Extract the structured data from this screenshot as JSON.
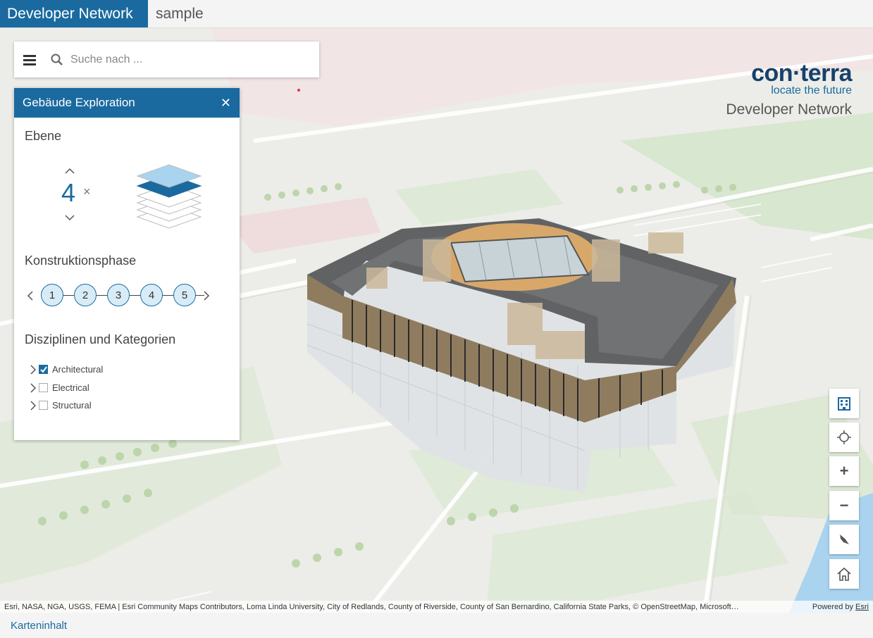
{
  "header": {
    "brand": "Developer Network",
    "app_name": "sample"
  },
  "search": {
    "placeholder": "Suche nach ..."
  },
  "panel": {
    "title": "Gebäude Exploration",
    "level_section": "Ebene",
    "level_value": "4",
    "level_clear": "×",
    "phase_section": "Konstruktionsphase",
    "phases": [
      "1",
      "2",
      "3",
      "4",
      "5"
    ],
    "disciplines_section": "Disziplinen und Kategorien",
    "categories": [
      {
        "label": "Architectural",
        "checked": true
      },
      {
        "label": "Electrical",
        "checked": false
      },
      {
        "label": "Structural",
        "checked": false
      }
    ]
  },
  "logo": {
    "main": "con·terra",
    "tagline": "locate the future",
    "network": "Developer Network"
  },
  "tools": [
    "building-icon",
    "locate-icon",
    "zoom-in-icon",
    "zoom-out-icon",
    "compass-icon",
    "home-icon"
  ],
  "zoom": {
    "in": "+",
    "out": "−"
  },
  "attribution": {
    "text": "Esri, NASA, NGA, USGS, FEMA | Esri Community Maps Contributors, Loma Linda University, City of Redlands, County of Riverside, County of San Bernardino, California State Parks, © OpenStreetMap, Microsoft…",
    "powered_by": "Powered by",
    "esri": "Esri"
  },
  "footer": {
    "link": "Karteninhalt"
  },
  "colors": {
    "accent": "#1a6aa0",
    "logo_dark": "#16416b"
  }
}
